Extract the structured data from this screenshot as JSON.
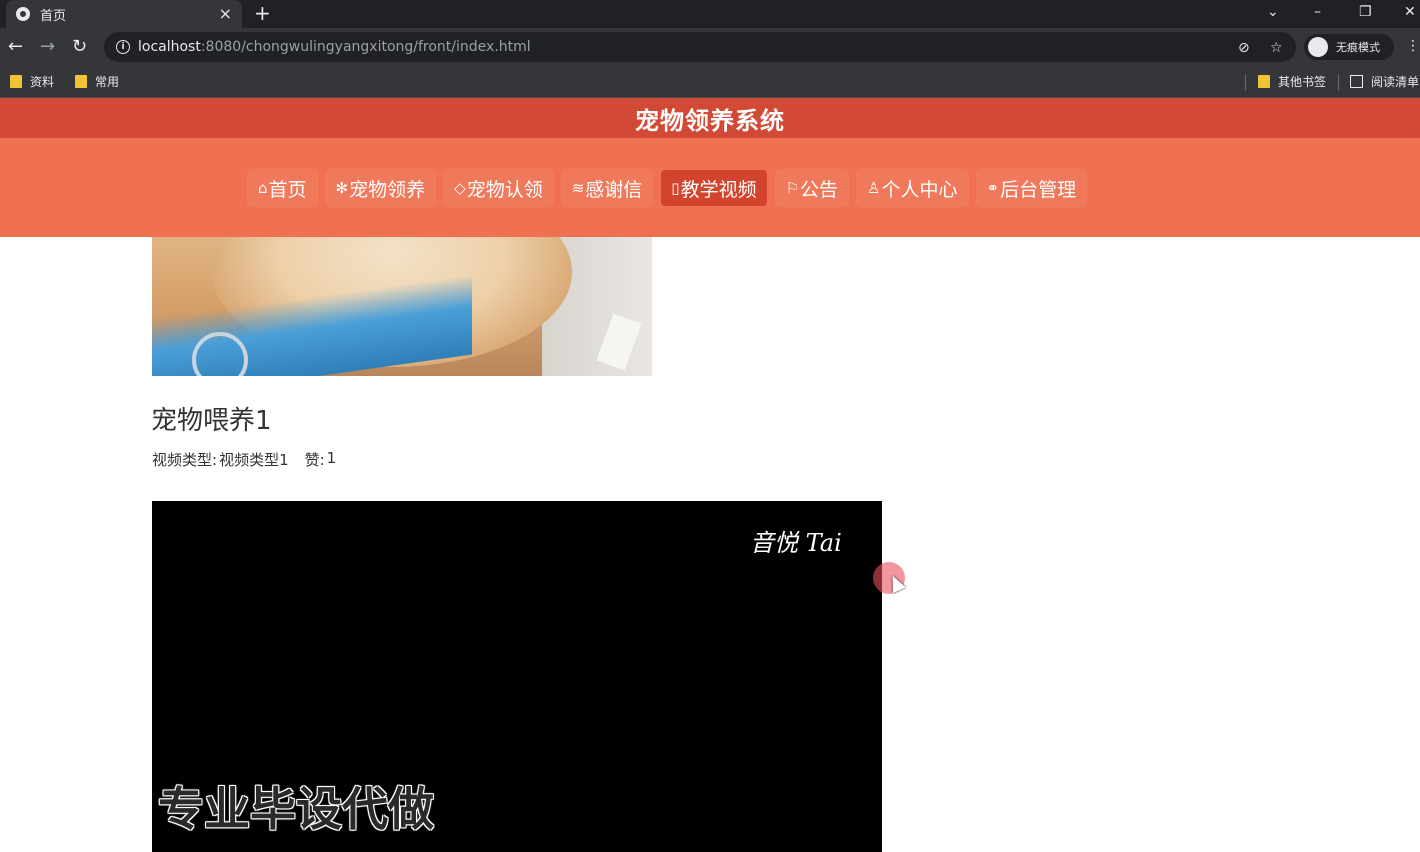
{
  "browser": {
    "tab_title": "首页",
    "tab_close": "×",
    "new_tab": "+",
    "url_host": "localhost",
    "url_path": ":8080/chongwulingyangxitong/front/index.html",
    "profile_label": "无痕模式",
    "bookmarks": [
      {
        "label": "资料"
      },
      {
        "label": "常用"
      }
    ],
    "bookmarks_right": [
      {
        "label": "其他书签"
      },
      {
        "label": "阅读清单"
      }
    ]
  },
  "site": {
    "title": "宠物领养系统",
    "nav": [
      {
        "icon": "⌂",
        "label": "首页",
        "active": false
      },
      {
        "icon": "✻",
        "label": "宠物领养",
        "active": false
      },
      {
        "icon": "◇",
        "label": "宠物认领",
        "active": false
      },
      {
        "icon": "≋",
        "label": "感谢信",
        "active": false
      },
      {
        "icon": "▯",
        "label": "教学视频",
        "active": true
      },
      {
        "icon": "⚐",
        "label": "公告",
        "active": false
      },
      {
        "icon": "♙",
        "label": "个人中心",
        "active": false
      },
      {
        "icon": "⚭",
        "label": "后台管理",
        "active": false
      }
    ]
  },
  "post": {
    "title": "宠物喂养1",
    "type_label": "视频类型:",
    "type_value": "视频类型1",
    "likes_label": "赞:",
    "likes_value": "1"
  },
  "video": {
    "watermark": "音悦 Tai",
    "caption": "专业毕设代做"
  },
  "colors": {
    "title_bar": "#d24a35",
    "nav_bar": "#f07152",
    "nav_active": "#d3442f"
  }
}
